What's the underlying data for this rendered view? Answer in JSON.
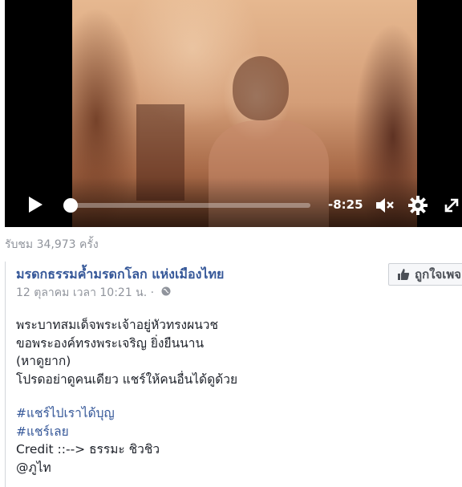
{
  "video": {
    "time_remaining": "-8:25",
    "progress_fraction": 0.02,
    "icons": [
      "play-icon",
      "volume-muted-icon",
      "settings-gear-icon",
      "fullscreen-icon"
    ]
  },
  "views_text": "รับชม 34,973 ครั้ง",
  "post": {
    "page_name": "มรดกธรรมค้ำมรดกโลก แห่งเมืองไทย",
    "timestamp": "12 ตุลาคม เวลา 10:21 น.",
    "separator": " · ",
    "like_button_label": "ถูกใจเพจ",
    "body_lines": [
      "พระบาทสมเด็จพระเจ้าอยู่หัวทรงผนวช",
      "ขอพระองค์ทรงพระเจริญ ยิ่งยืนนาน",
      "(หาดูยาก)",
      "โปรดอย่าดูคนเดียว แชร์ให้คนอื่นได้ดูด้วย"
    ],
    "hashtags": [
      "#แชร์ไปเราได้บุญ",
      "#แชร์เลย"
    ],
    "credit_line": "Credit ::--> ธรรมะ ชิวชิว",
    "mention": "@ภูไท"
  },
  "colors": {
    "link_blue": "#365899",
    "meta_gray": "#90949c",
    "text": "#1d2129"
  }
}
